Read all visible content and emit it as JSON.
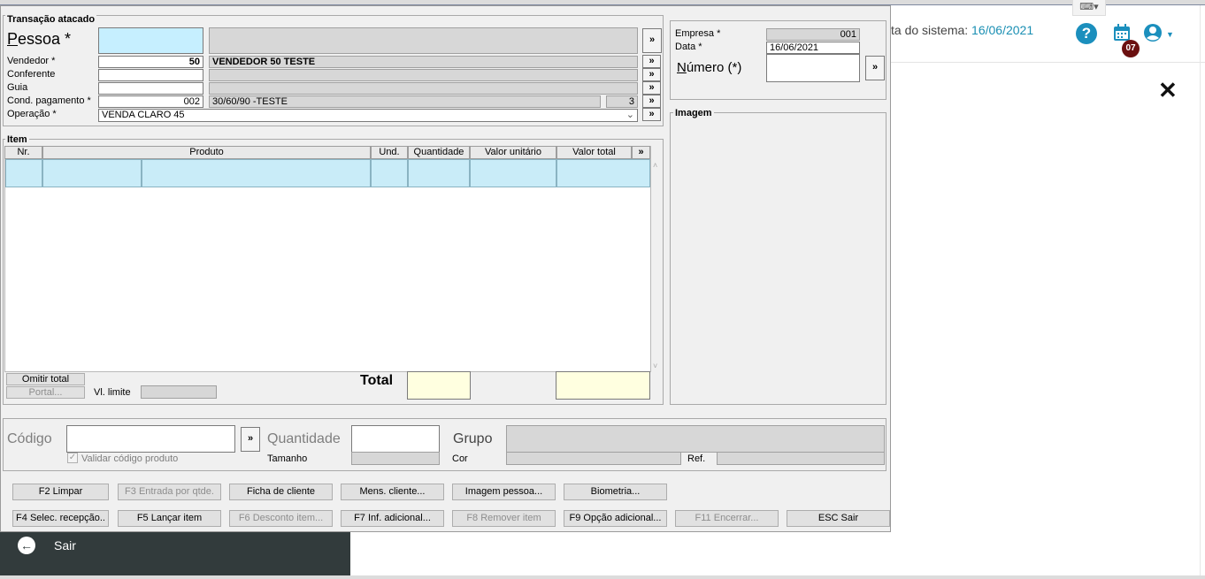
{
  "web": {
    "date_label": "ta do sistema:",
    "date_value": "16/06/2021",
    "help_icon": "question-circle-icon",
    "calendar_badge": "07",
    "close_icon": "close-x-icon",
    "sair_label": "Sair"
  },
  "dialog": {
    "transacao_title": "Transação atacado",
    "pessoa_label": "Pessoa *",
    "vendedor_label": "Vendedor *",
    "vendedor_code": "50",
    "vendedor_name": "VENDEDOR 50 TESTE",
    "conferente_label": "Conferente",
    "guia_label": "Guia",
    "cond_label": "Cond. pagamento *",
    "cond_code": "002",
    "cond_name": "30/60/90 -TESTE",
    "cond_count": "3",
    "operacao_label": "Operação *",
    "operacao_value": "VENDA CLARO 45",
    "more": "»",
    "empresa_label": "Empresa *",
    "empresa_value": "001",
    "data_label": "Data *",
    "data_value": "16/06/2021",
    "numero_label": "Número (*)",
    "imagem_title": "Imagem",
    "item_title": "Item",
    "columns": [
      "Nr.",
      "Produto",
      "Und.",
      "Quantidade",
      "Valor unitário",
      "Valor total"
    ],
    "omitir_total": "Omitir total",
    "portal": "Portal...",
    "vl_limite": "Vl. limite",
    "total_label": "Total",
    "codigo_label": "Código",
    "quantidade_label": "Quantidade",
    "grupo_label": "Grupo",
    "validar_label": "Validar código produto",
    "tamanho_label": "Tamanho",
    "cor_label": "Cor",
    "ref_label": "Ref.",
    "buttons_row1": [
      "F2 Limpar",
      "F3 Entrada por qtde.",
      "Ficha de cliente",
      "Mens. cliente...",
      "Imagem pessoa...",
      "Biometria..."
    ],
    "buttons_row2": [
      "F4 Selec. recepção..",
      "F5 Lançar item",
      "F6 Desconto item...",
      "F7 Inf. adicional...",
      "F8 Remover item",
      "F9 Opção adicional...",
      "F11 Encerrar...",
      "ESC Sair"
    ]
  }
}
